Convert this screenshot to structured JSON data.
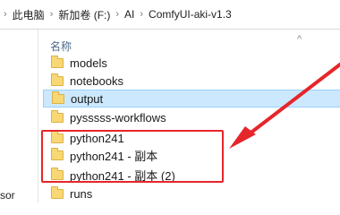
{
  "breadcrumb": {
    "items": [
      "此电脑",
      "新加卷 (F:)",
      "AI",
      "ComfyUI-aki-v1.3"
    ],
    "separator": "›"
  },
  "nav": {
    "partial_text": "sor"
  },
  "column": {
    "name_label": "名称",
    "sort_indicator": "^"
  },
  "files": [
    {
      "name": "models"
    },
    {
      "name": "notebooks"
    },
    {
      "name": "output",
      "selected": true
    },
    {
      "name": "pysssss-workflows"
    },
    {
      "name": "python241"
    },
    {
      "name": "python241 - 副本"
    },
    {
      "name": "python241 - 副本 (2)"
    },
    {
      "name": "runs"
    }
  ],
  "colors": {
    "folder": "#f8d775",
    "selection": "#cce8ff",
    "annotation": "#e5262a"
  }
}
